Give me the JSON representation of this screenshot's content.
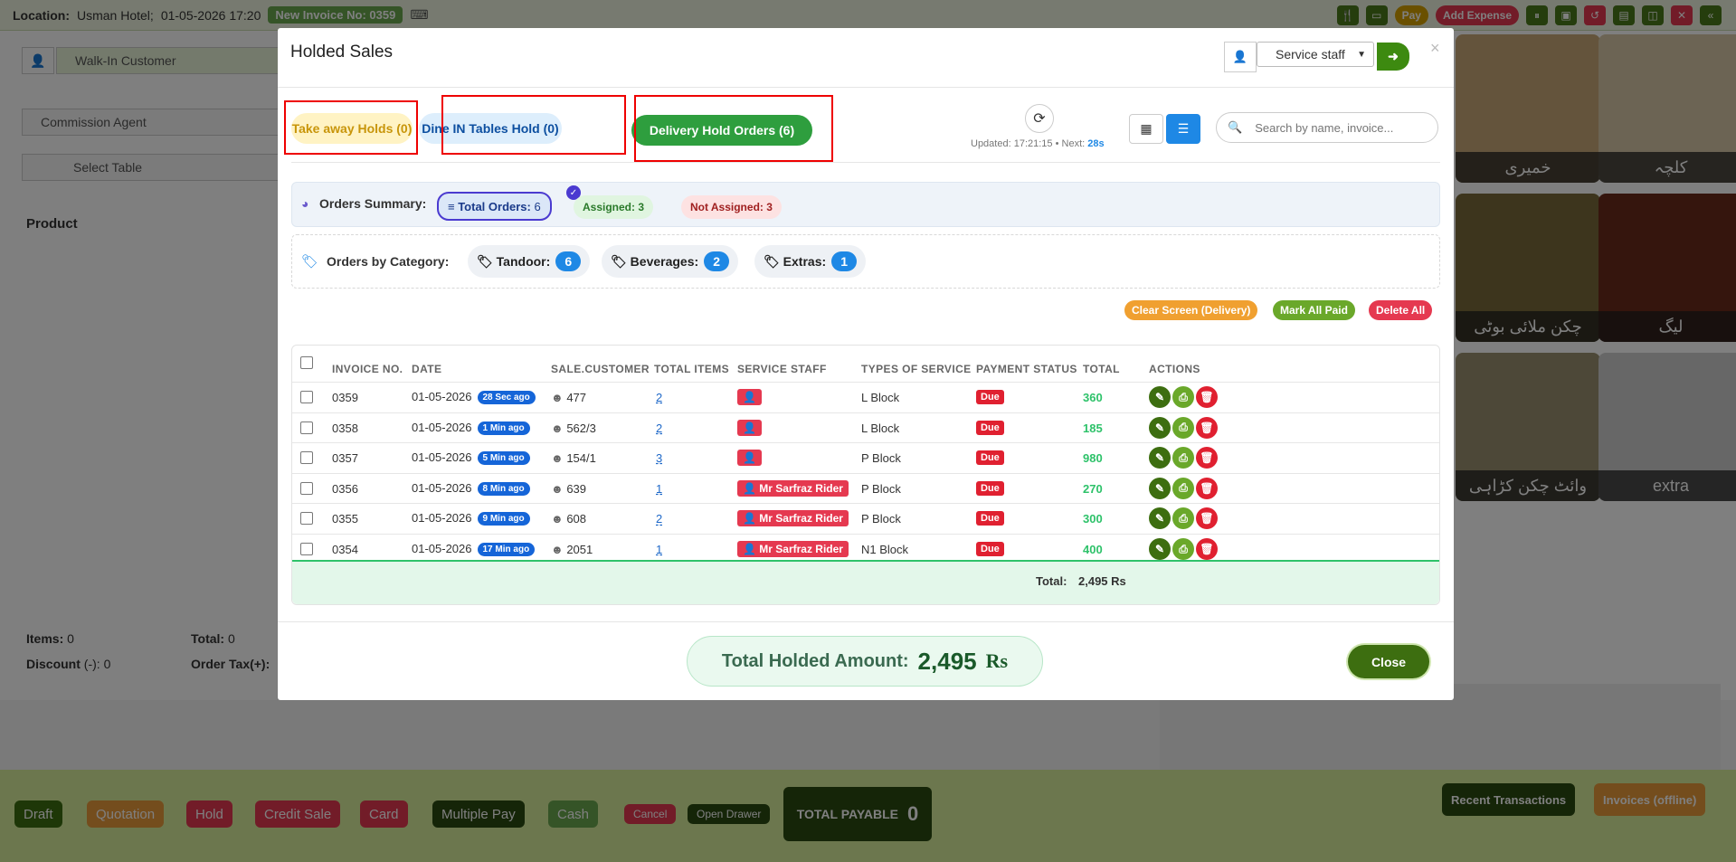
{
  "topbar": {
    "location_label": "Location:",
    "location_value": "Usman Hotel;",
    "datetime": "01-05-2026 17:20",
    "invoice_label": "New Invoice No:",
    "invoice_no": "0359",
    "pay": "Pay",
    "add_expense": "Add Expense"
  },
  "left": {
    "customer": "Walk-In Customer",
    "agent": "Commission Agent",
    "table": "Select Table",
    "product_label": "Product",
    "items_label": "Items:",
    "items_value": "0",
    "total_label": "Total:",
    "total_value": "0",
    "discount_label": "Discount",
    "discount_value": "(-):",
    "discount_amount": "0",
    "order_tax_label": "Order Tax(+):"
  },
  "right": {
    "tiles": [
      "خمیری",
      "کلچہ",
      "چکن ملائی بوٹی",
      "لیگ",
      "وائٹ چکن کڑاہی",
      "extra"
    ]
  },
  "bottom": {
    "draft": "Draft",
    "quotation": "Quotation",
    "hold": "Hold",
    "credit_sale": "Credit Sale",
    "card": "Card",
    "multiple_pay": "Multiple Pay",
    "cash": "Cash",
    "cancel": "Cancel",
    "open_drawer": "Open Drawer",
    "total_payable_label": "TOTAL PAYABLE",
    "total_payable_value": "0",
    "recent_transactions": "Recent Transactions",
    "invoices_offline": "Invoices (offline)"
  },
  "modal": {
    "title": "Holded Sales",
    "service_staff": "Service staff",
    "tabs": {
      "takeaway": "Take away Holds (0)",
      "dinein": "Dine IN Tables Hold (0)",
      "delivery": "Delivery Hold Orders (6)"
    },
    "updated_label": "Updated:",
    "updated_time": "17:21:15",
    "next_label": "Next:",
    "next_value": "28s",
    "search_placeholder": "Search by name, invoice...",
    "summary": {
      "label": "Orders Summary:",
      "total_label": "Total Orders:",
      "total_value": "6",
      "assigned": "Assigned: 3",
      "not_assigned": "Not Assigned: 3"
    },
    "categories": {
      "label": "Orders by Category:",
      "items": [
        {
          "name": "Tandoor:",
          "count": "6"
        },
        {
          "name": "Beverages:",
          "count": "2"
        },
        {
          "name": "Extras:",
          "count": "1"
        }
      ]
    },
    "actions": {
      "clear": "Clear Screen (Delivery)",
      "mark_paid": "Mark All Paid",
      "delete_all": "Delete All"
    },
    "columns": [
      "INVOICE NO.",
      "DATE",
      "SALE.CUSTOMER",
      "TOTAL ITEMS",
      "SERVICE STAFF",
      "TYPES OF SERVICE",
      "PAYMENT STATUS",
      "TOTAL",
      "ACTIONS"
    ],
    "rows": [
      {
        "invoice": "0359",
        "date": "01-05-2026",
        "ago": "28 Sec ago",
        "customer": "477",
        "items": "2",
        "staff": "",
        "service": "L Block",
        "status": "Due",
        "total": "360"
      },
      {
        "invoice": "0358",
        "date": "01-05-2026",
        "ago": "1 Min ago",
        "customer": "562/3",
        "items": "2",
        "staff": "",
        "service": "L Block",
        "status": "Due",
        "total": "185"
      },
      {
        "invoice": "0357",
        "date": "01-05-2026",
        "ago": "5 Min ago",
        "customer": "154/1",
        "items": "3",
        "staff": "",
        "service": "P Block",
        "status": "Due",
        "total": "980"
      },
      {
        "invoice": "0356",
        "date": "01-05-2026",
        "ago": "8 Min ago",
        "customer": "639",
        "items": "1",
        "staff": "Mr Sarfraz Rider",
        "service": "P Block",
        "status": "Due",
        "total": "270"
      },
      {
        "invoice": "0355",
        "date": "01-05-2026",
        "ago": "9 Min ago",
        "customer": "608",
        "items": "2",
        "staff": "Mr Sarfraz Rider",
        "service": "P Block",
        "status": "Due",
        "total": "300"
      },
      {
        "invoice": "0354",
        "date": "01-05-2026",
        "ago": "17 Min ago",
        "customer": "2051",
        "items": "1",
        "staff": "Mr Sarfraz Rider",
        "service": "N1 Block",
        "status": "Due",
        "total": "400"
      }
    ],
    "footer_total_label": "Total:",
    "footer_total_value": "2,495 Rs",
    "holded_label": "Total Holded Amount:",
    "holded_value": "2,495",
    "holded_unit": "Rs",
    "close": "Close",
    "colors": {
      "green": "#2e9e3e",
      "dark_green": "#3d6e10",
      "blue": "#1e88e5",
      "red": "#e53950"
    }
  }
}
